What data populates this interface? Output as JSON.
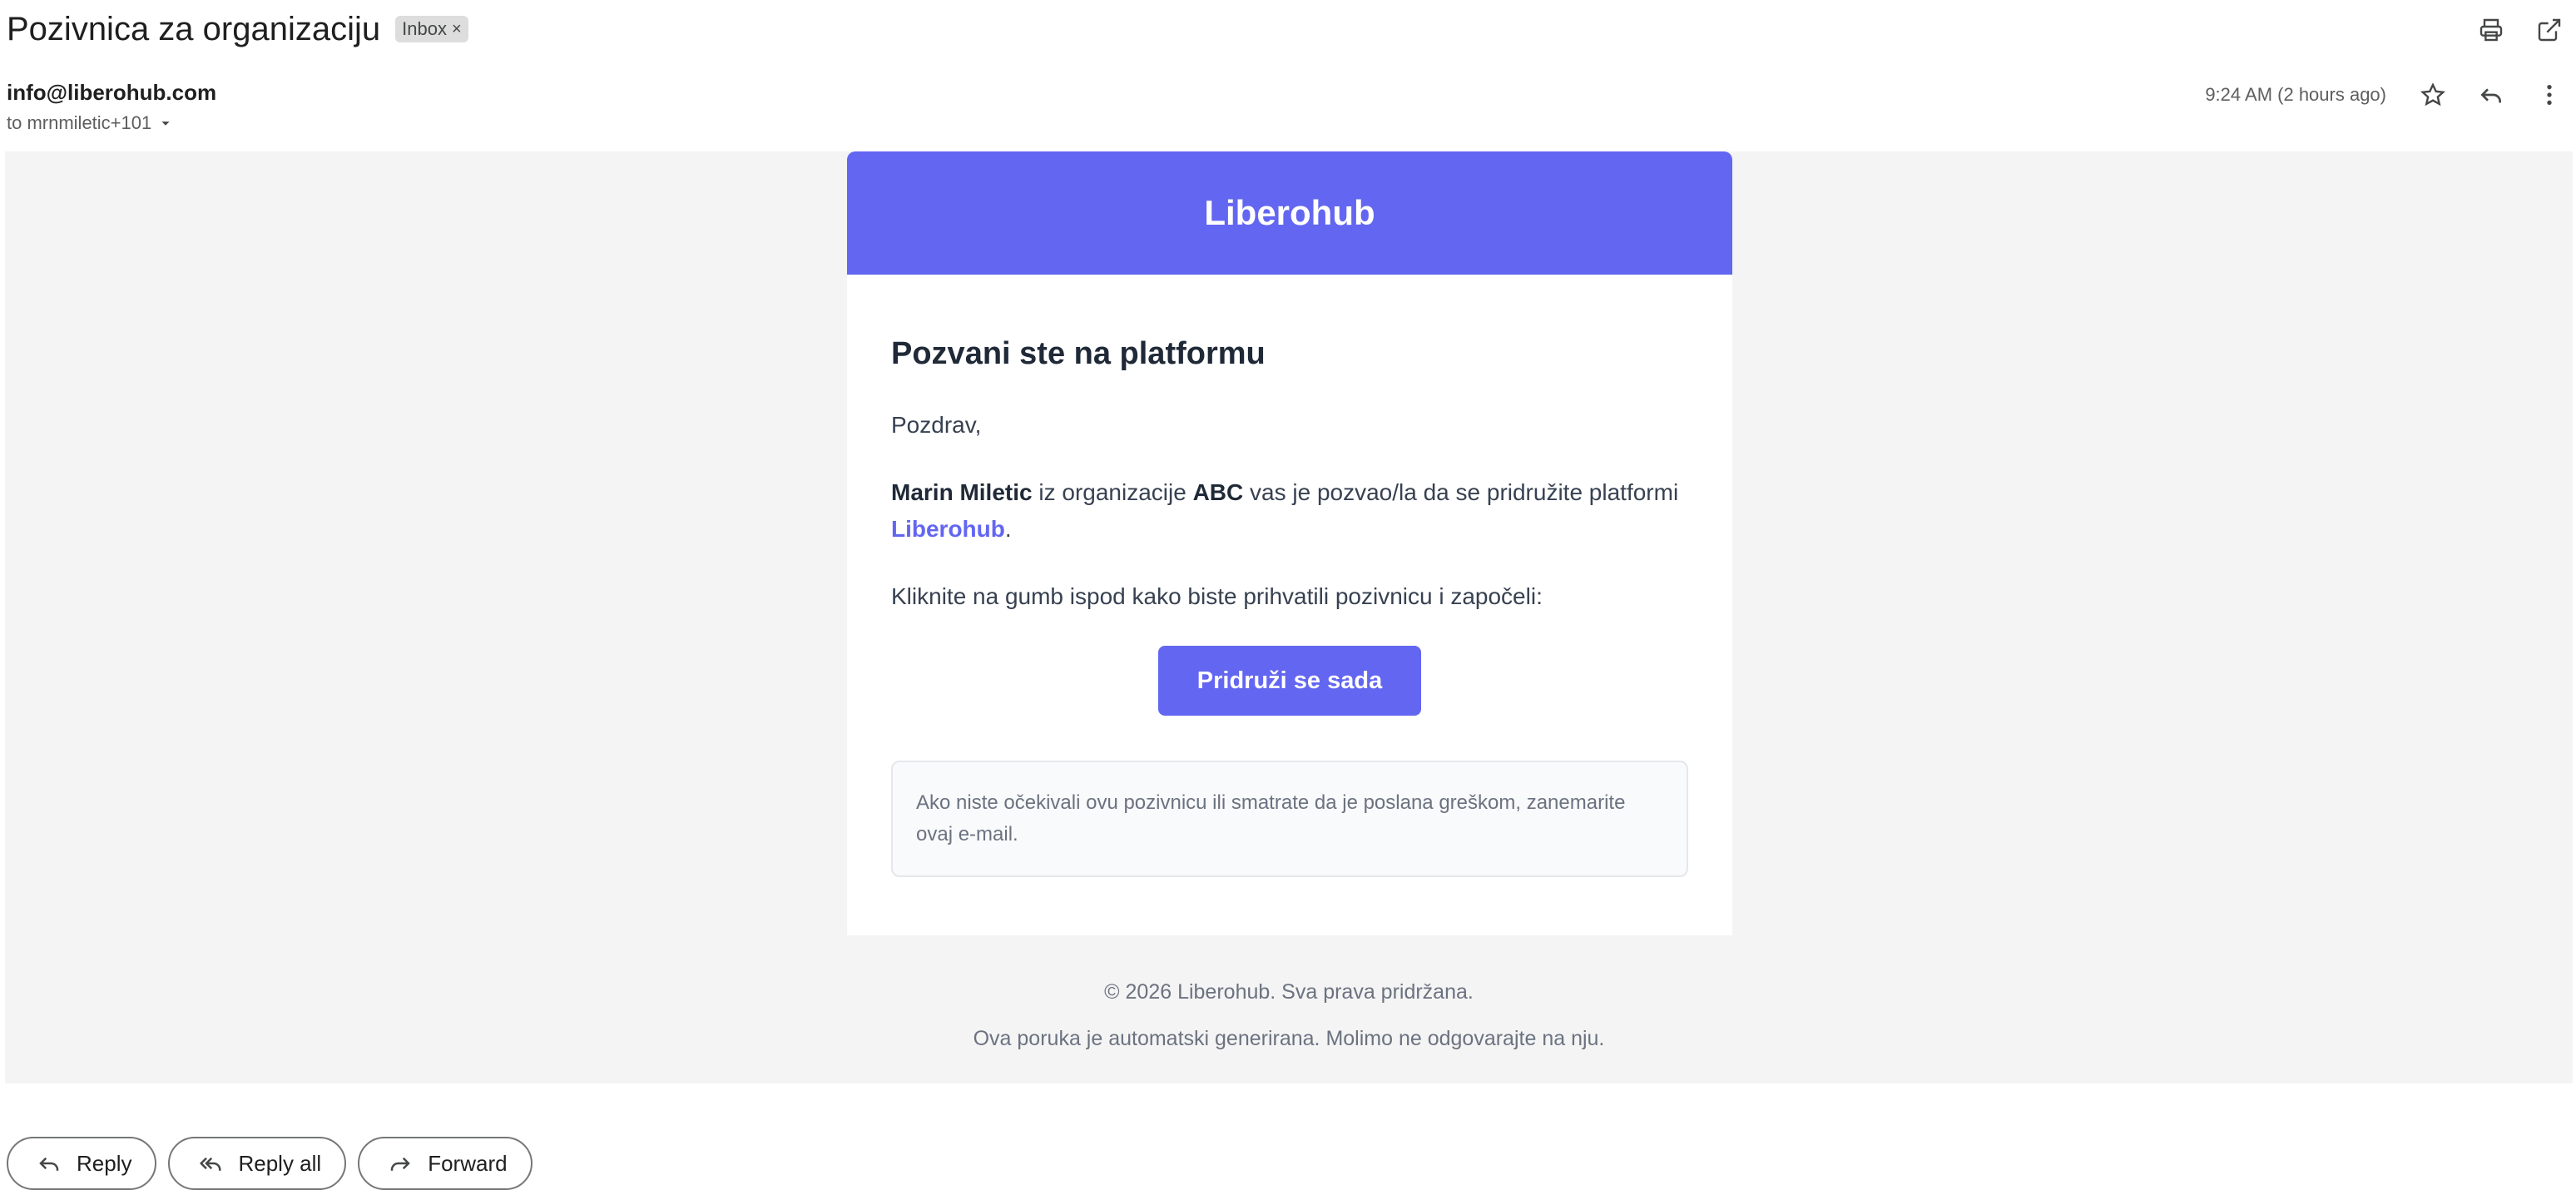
{
  "email": {
    "subject": "Pozivnica za organizaciju",
    "label": "Inbox",
    "label_close": "×",
    "sender": "info@liberohub.com",
    "recipient": "to mrnmiletic+101",
    "timestamp": "9:24 AM (2 hours ago)"
  },
  "message": {
    "brand": "Liberohub",
    "title": "Pozvani ste na platformu",
    "greeting": "Pozdrav,",
    "inviter_name": "Marin Miletic",
    "text_from_org": " iz organizacije ",
    "org_name": "ABC",
    "text_invited": " vas je pozvao/la da se pridružite platformi ",
    "platform_link": "Liberohub",
    "period": ".",
    "instruction": "Kliknite na gumb ispod kako biste prihvatili pozivnicu i započeli:",
    "cta_label": "Pridruži se sada",
    "notice": "Ako niste očekivali ovu pozivnicu ili smatrate da je poslana greškom, zanemarite ovaj e-mail.",
    "footer_copyright": "© 2026 Liberohub. Sva prava pridržana.",
    "footer_auto": "Ova poruka je automatski generirana. Molimo ne odgovarajte na nju."
  },
  "actions": {
    "reply": "Reply",
    "reply_all": "Reply all",
    "forward": "Forward"
  },
  "icons": {
    "print": "print-icon",
    "open_new_window": "open-in-new-window-icon",
    "star": "star-icon",
    "reply": "reply-icon",
    "more": "more-vertical-icon",
    "dropdown": "caret-down-icon",
    "reply_all": "reply-all-icon",
    "forward": "forward-icon"
  },
  "colors": {
    "brand": "#6366f1",
    "canvas_bg": "#f4f4f4"
  }
}
